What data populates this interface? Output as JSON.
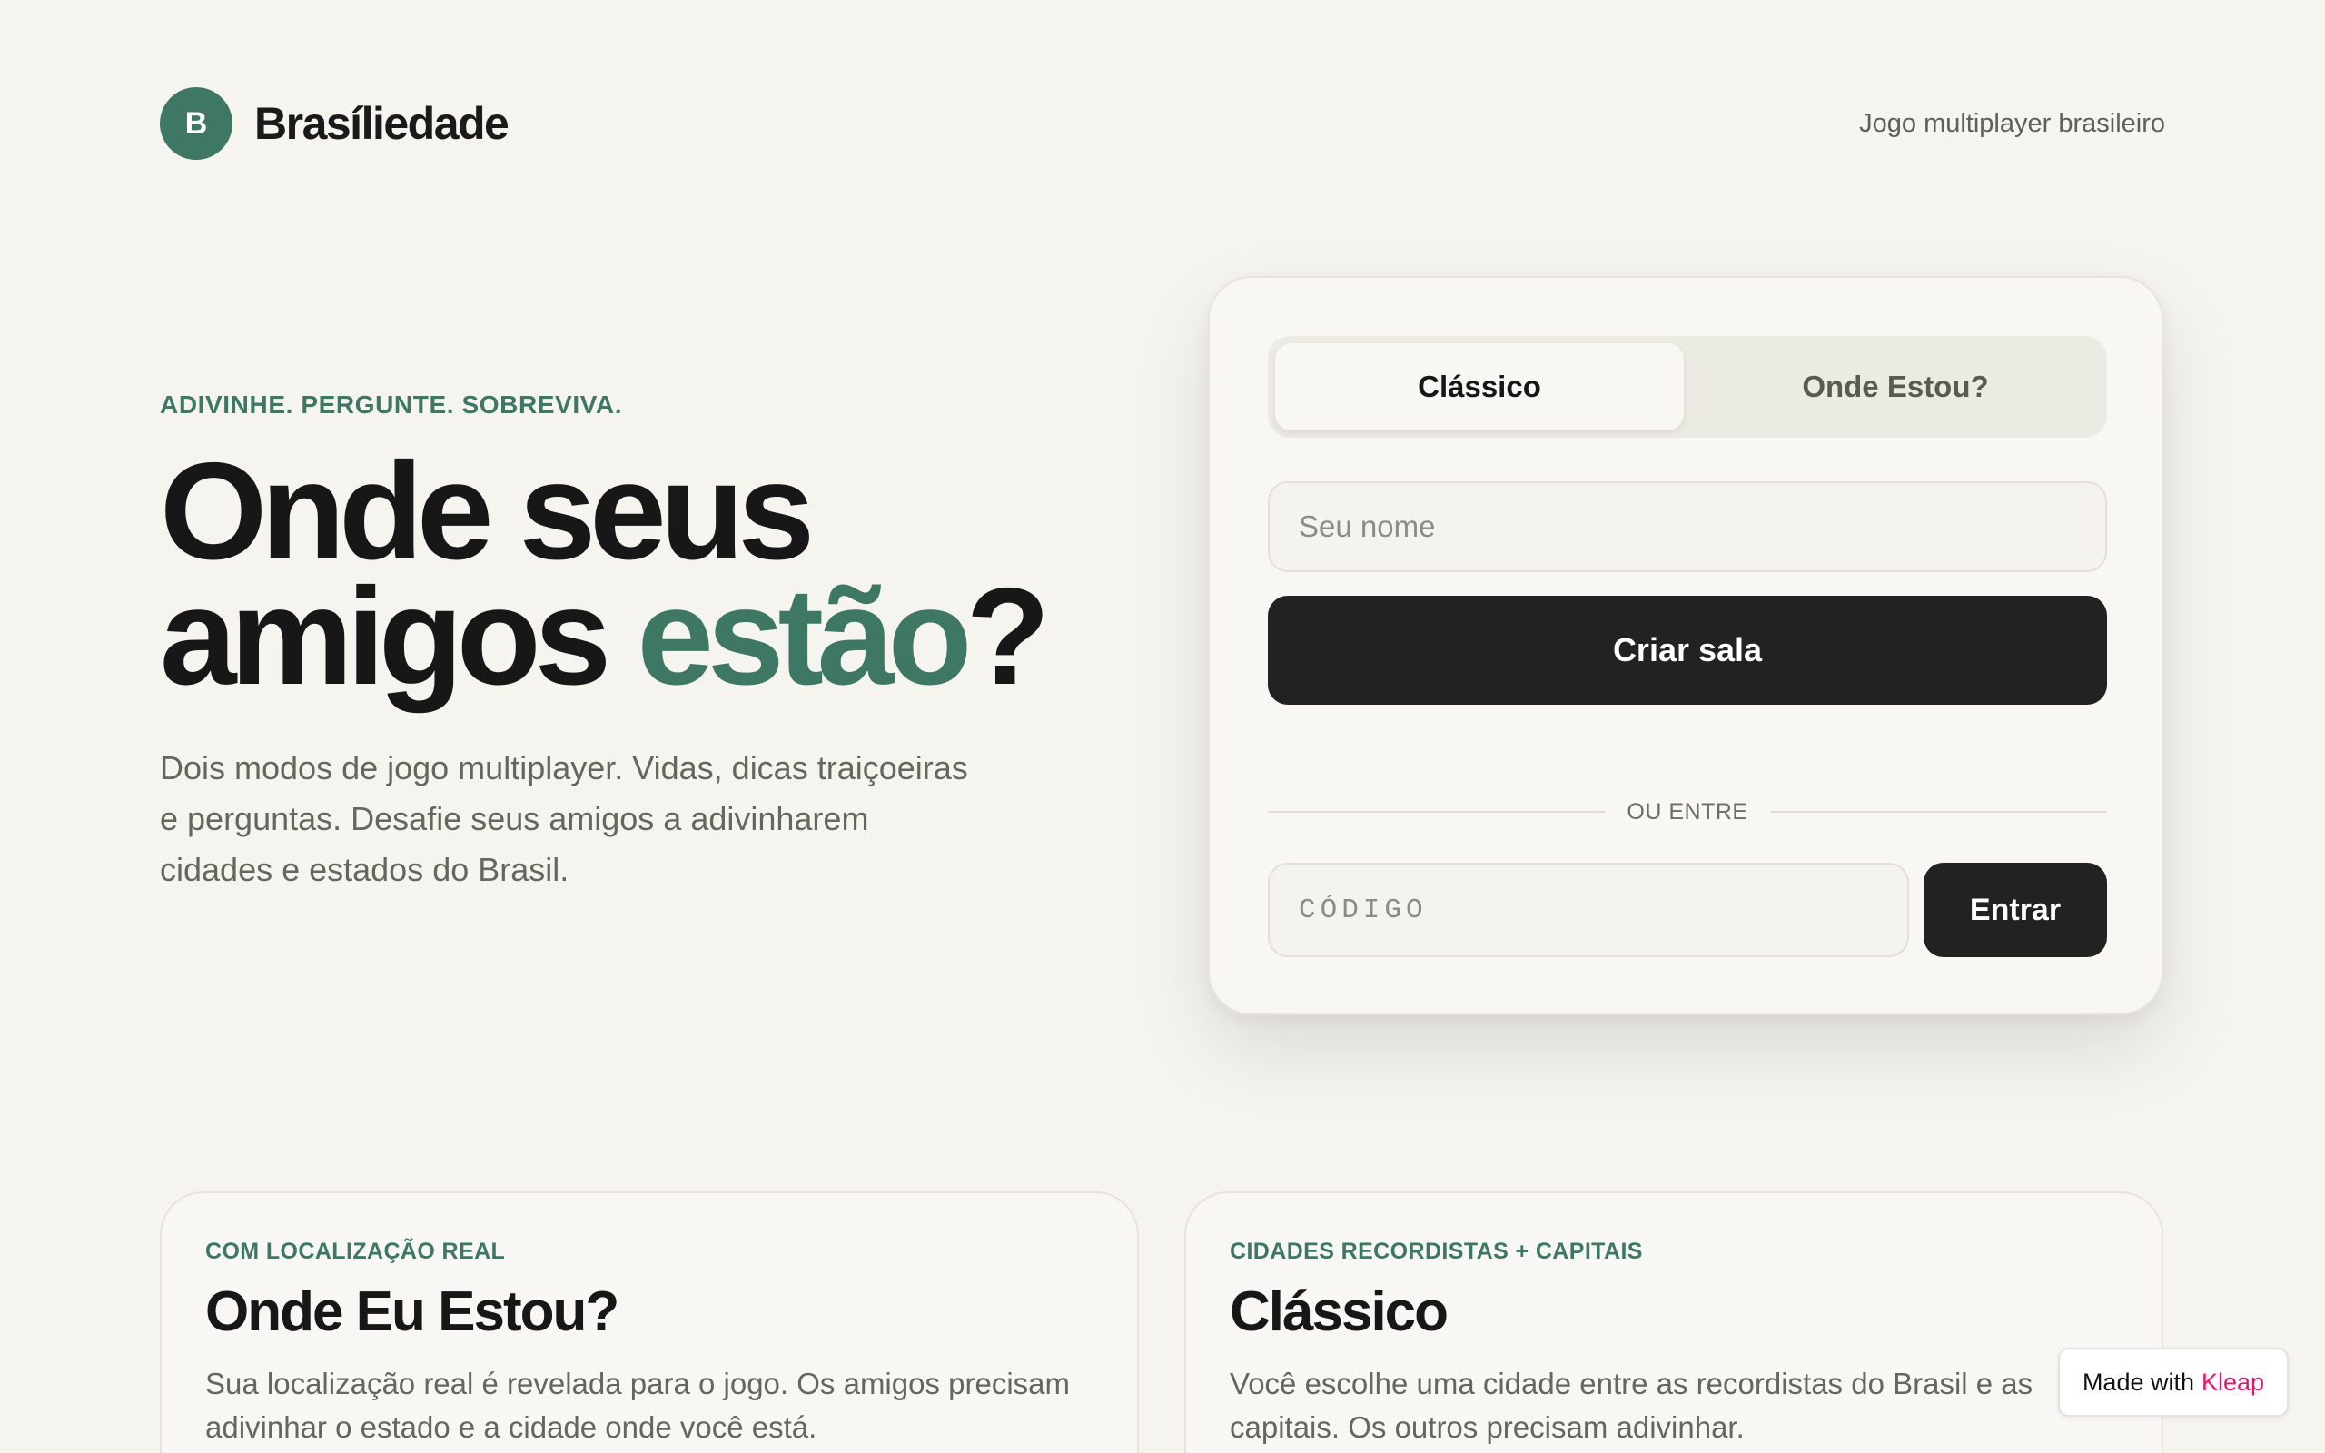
{
  "header": {
    "logo_letter": "B",
    "brand_name": "Brasíliedade",
    "tagline": "Jogo multiplayer brasileiro"
  },
  "hero": {
    "eyebrow": "ADIVINHE. PERGUNTE. SOBREVIVA.",
    "headline_line1": "Onde seus",
    "headline_line2_start": "amigos",
    "headline_accent": "estão",
    "headline_end": "?",
    "description": "Dois modos de jogo multiplayer. Vidas, dicas traiçoeiras e perguntas. Desafie seus amigos a adivinharem cidades e estados do Brasil."
  },
  "card": {
    "tabs": [
      {
        "label": "Clássico",
        "active": true
      },
      {
        "label": "Onde Estou?",
        "active": false
      }
    ],
    "name_placeholder": "Seu nome",
    "create_button": "Criar sala",
    "divider_text": "OU ENTRE",
    "code_placeholder": "CÓDIGO",
    "join_button": "Entrar"
  },
  "modes": [
    {
      "eyebrow": "COM LOCALIZAÇÃO REAL",
      "title": "Onde Eu Estou?",
      "description": "Sua localização real é revelada para o jogo. Os amigos precisam adivinhar o estado e a cidade onde você está."
    },
    {
      "eyebrow": "CIDADES RECORDISTAS + CAPITAIS",
      "title": "Clássico",
      "description": "Você escolhe uma cidade entre as recordistas do Brasil e as capitais. Os outros precisam adivinhar."
    }
  ],
  "badge": {
    "prefix": "Made with",
    "brand": "Kleap"
  },
  "colors": {
    "background": "#f5f4ef",
    "accent": "#3e7764",
    "button_dark": "#222222",
    "badge_brand": "#e2186b"
  }
}
